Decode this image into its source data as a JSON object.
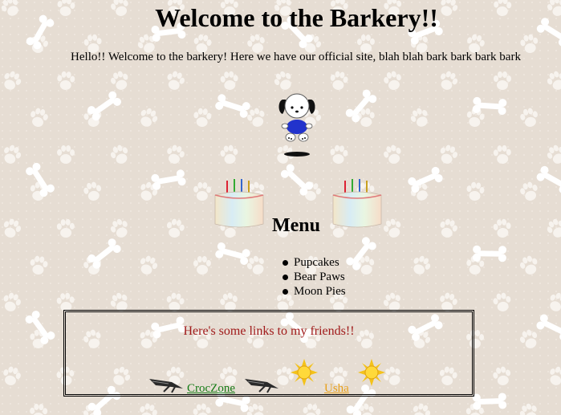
{
  "page": {
    "title": "Welcome to the Barkery!!",
    "intro": "Hello!! Welcome to the barkery! Here we have our official site, blah blah bark bark bark bark"
  },
  "images": {
    "mascot": "puppy-mascot",
    "cake": "birthday-cake-icon",
    "croc": "crocodile-icon",
    "sun": "sun-icon"
  },
  "menu": {
    "title": "Menu",
    "items": [
      "Pupcakes",
      "Bear Paws",
      "Moon Pies"
    ]
  },
  "friends": {
    "heading": "Here's some links to my friends!!",
    "links": [
      {
        "label": "CrocZone ",
        "color": "#147a14"
      },
      {
        "label": "Usha",
        "color": "#e8a01a"
      }
    ]
  },
  "colors": {
    "background": "#e6ddd3",
    "paw": "#f7f3ee",
    "heading_red": "#a01a1a"
  }
}
